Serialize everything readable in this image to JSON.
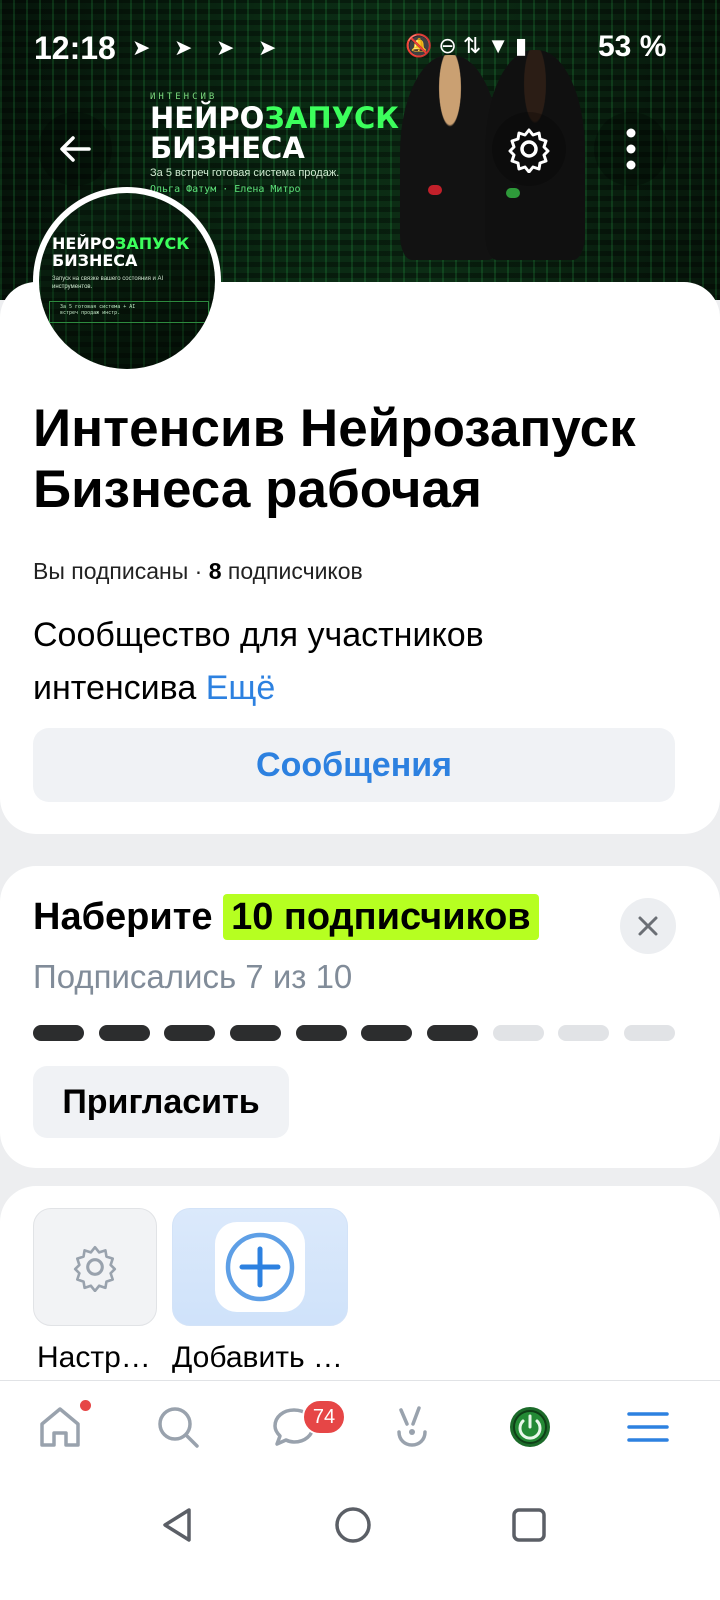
{
  "status_bar": {
    "time": "12:18",
    "telegram_icons": [
      "telegram-icon",
      "telegram-icon",
      "telegram-icon",
      "telegram-icon"
    ],
    "system_icons": "🔕⊖⇅▼▮",
    "battery": "53 %"
  },
  "cover": {
    "kicker": "ИНТЕНСИВ",
    "title_part1": "НЕЙРО",
    "title_part2": "ЗАПУСК",
    "title_line2": "БИЗНЕСА",
    "subtitle": "За 5 встреч готовая система продаж.",
    "names": "Ольга Фатум  ·  Елена Митро"
  },
  "avatar": {
    "title_part1": "НЕЙРО",
    "title_part2": "ЗАПУСК",
    "title_line2": "БИЗНЕСА",
    "subtitle": "Запуск на связке вашего состояния и AI инструментов.",
    "table_row1": "За 5      готовая система   + AI",
    "table_row2": "встреч    продаж            инстр."
  },
  "community": {
    "name": "Интенсив Нейрозапуск Бизнеса рабочая",
    "subscribed_text": "Вы подписаны · ",
    "subscriber_count": "8",
    "subscriber_word": " подписчиков",
    "description": "Сообщество для участников интенсива ",
    "more_link": "Ещё",
    "messages_button": "Сообщения"
  },
  "goal": {
    "title_prefix": "Наберите ",
    "title_highlight": "10 подписчиков",
    "progress_text": "Подписались 7 из 10",
    "progress_value": 7,
    "progress_total": 10,
    "invite_button": "Пригласить",
    "close_icon": "close-icon"
  },
  "apps": {
    "settings_label": "Настр…",
    "add_label": "Добавить …"
  },
  "tabbar": {
    "messages_badge": "74",
    "items": [
      "home-icon",
      "search-icon",
      "messages-icon",
      "clips-icon",
      "power-icon",
      "menu-icon"
    ]
  },
  "colors": {
    "accent_blue": "#2d81e0",
    "highlight": "#b6ff21",
    "badge_red": "#e64646",
    "neon_green": "#3cff5c"
  }
}
